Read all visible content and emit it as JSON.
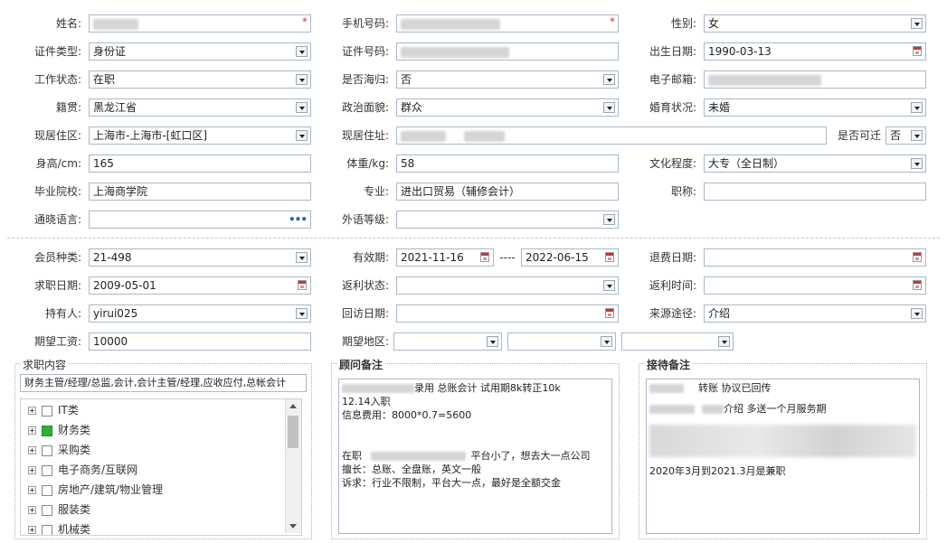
{
  "row1": {
    "name_label": "姓名:",
    "phone_label": "手机号码:",
    "gender_label": "性别:",
    "gender_value": "女",
    "required_mark": "*"
  },
  "row2": {
    "idtype_label": "证件类型:",
    "idtype_value": "身份证",
    "idno_label": "证件号码:",
    "birth_label": "出生日期:",
    "birth_value": "1990-03-13"
  },
  "row3": {
    "work_label": "工作状态:",
    "work_value": "在职",
    "returnee_label": "是否海归:",
    "returnee_value": "否",
    "email_label": "电子邮箱:"
  },
  "row4": {
    "native_label": "籍贯:",
    "native_value": "黑龙江省",
    "political_label": "政治面貌:",
    "political_value": "群众",
    "marital_label": "婚育状况:",
    "marital_value": "未婚"
  },
  "row5": {
    "district_label": "现居住区:",
    "district_value": "上海市-上海市-[虹口区]",
    "address_label": "现居住址:",
    "relocate_label": "是否可迁",
    "relocate_value": "否"
  },
  "row6": {
    "height_label": "身高/cm:",
    "height_value": "165",
    "weight_label": "体重/kg:",
    "weight_value": "58",
    "edu_label": "文化程度:",
    "edu_value": "大专（全日制）"
  },
  "row7": {
    "school_label": "毕业院校:",
    "school_value": "上海商学院",
    "major_label": "专业:",
    "major_value": "进出口贸易（辅修会计）",
    "title_label": "职称:"
  },
  "row8": {
    "lang_label": "通晓语言:",
    "foreign_label": "外语等级:"
  },
  "row9": {
    "member_label": "会员种类:",
    "member_value": "21-498",
    "valid_label": "有效期:",
    "valid_from": "2021-11-16",
    "valid_sep": "----",
    "valid_to": "2022-06-15",
    "refund_label": "退费日期:"
  },
  "row10": {
    "apply_label": "求职日期:",
    "apply_value": "2009-05-01",
    "rebate_label": "返利状态:",
    "rebate_time_label": "返利时间:"
  },
  "row11": {
    "holder_label": "持有人:",
    "holder_value": "yirui025",
    "revisit_label": "回访日期:",
    "source_label": "来源途径:",
    "source_value": "介绍"
  },
  "row12": {
    "salary_label": "期望工资:",
    "salary_value": "10000",
    "region_label": "期望地区:"
  },
  "job": {
    "title": "求职内容",
    "summary": "财务主管/经理/总监,会计,会计主管/经理,应收应付,总帐会计",
    "items": [
      {
        "label": "IT类",
        "checked": false
      },
      {
        "label": "财务类",
        "checked": true
      },
      {
        "label": "采购类",
        "checked": false
      },
      {
        "label": "电子商务/互联网",
        "checked": false
      },
      {
        "label": "房地产/建筑/物业管理",
        "checked": false
      },
      {
        "label": "服装类",
        "checked": false
      },
      {
        "label": "机械类",
        "checked": false
      }
    ]
  },
  "advisor": {
    "title": "顾问备注",
    "line1": "录用  总账会计  试用期8k转正10k",
    "line2": "12.14入职",
    "line3": "信息费用：8000*0.7=5600",
    "line4a": "在职",
    "line4b": "平台小了，想去大一点公司",
    "line5": "擅长：总账、全盘账，英文一般",
    "line6": "诉求：行业不限制，平台大一点，最好是全额交金"
  },
  "reception": {
    "title": "接待备注",
    "line1": "转账    协议已回传",
    "line2": "介绍    多送一个月服务期",
    "line3": "2020年3月到2021.3月是兼职"
  },
  "colors": {
    "border": "#a9b8c8",
    "required": "#e03030",
    "checked": "#2fae3c"
  }
}
